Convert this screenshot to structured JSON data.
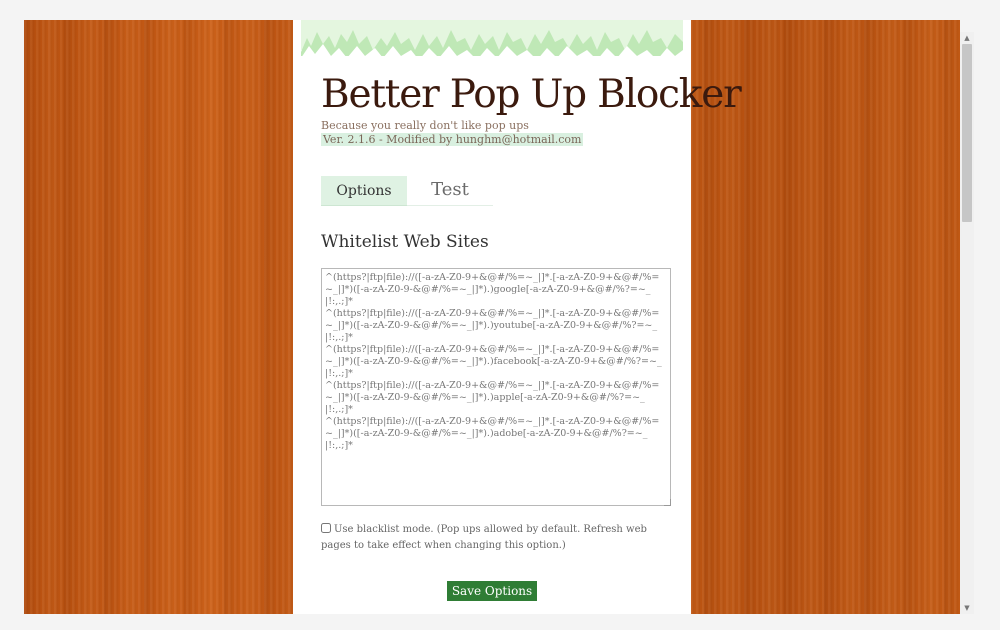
{
  "app": {
    "title": "Better Pop Up Blocker",
    "subtitle": "Because you really don't like pop ups",
    "version": "Ver. 2.1.6 - Modified by hunghm@hotmail.com"
  },
  "tabs": [
    {
      "label": "Options",
      "active": true
    },
    {
      "label": "Test",
      "active": false
    }
  ],
  "whitelist": {
    "heading": "Whitelist Web Sites",
    "value": "^(https?|ftp|file)://([-a-zA-Z0-9+&@#/%=~_|]*.[-a-zA-Z0-9+&@#/%=~_|]*)([-a-zA-Z0-9-&@#/%=~_|]*).)google[-a-zA-Z0-9+&@#/%?=~_|!:,.;]*\n^(https?|ftp|file)://([-a-zA-Z0-9+&@#/%=~_|]*.[-a-zA-Z0-9+&@#/%=~_|]*)([-a-zA-Z0-9-&@#/%=~_|]*).)youtube[-a-zA-Z0-9+&@#/%?=~_|!:,.;]*\n^(https?|ftp|file)://([-a-zA-Z0-9+&@#/%=~_|]*.[-a-zA-Z0-9+&@#/%=~_|]*)([-a-zA-Z0-9-&@#/%=~_|]*).)facebook[-a-zA-Z0-9+&@#/%?=~_|!:,.;]*\n^(https?|ftp|file)://([-a-zA-Z0-9+&@#/%=~_|]*.[-a-zA-Z0-9+&@#/%=~_|]*)([-a-zA-Z0-9-&@#/%=~_|]*).)apple[-a-zA-Z0-9+&@#/%?=~_|!:,.;]*\n^(https?|ftp|file)://([-a-zA-Z0-9+&@#/%=~_|]*.[-a-zA-Z0-9+&@#/%=~_|]*)([-a-zA-Z0-9-&@#/%=~_|]*).)adobe[-a-zA-Z0-9+&@#/%?=~_|!:,.;]*"
  },
  "blacklist_mode": {
    "checked": false,
    "label": "Use blacklist mode. (Pop ups allowed by default. Refresh web pages to take effect when changing this option.)"
  },
  "save_button": "Save Options",
  "colors": {
    "wood": "#c05814",
    "tab_active_bg": "#dff2e3",
    "version_bg": "#d9f0e0",
    "button_green": "#2f7d35",
    "title_color": "#3b1a0e"
  },
  "icons": {
    "scroll_up": "▲",
    "scroll_down": "▼"
  }
}
